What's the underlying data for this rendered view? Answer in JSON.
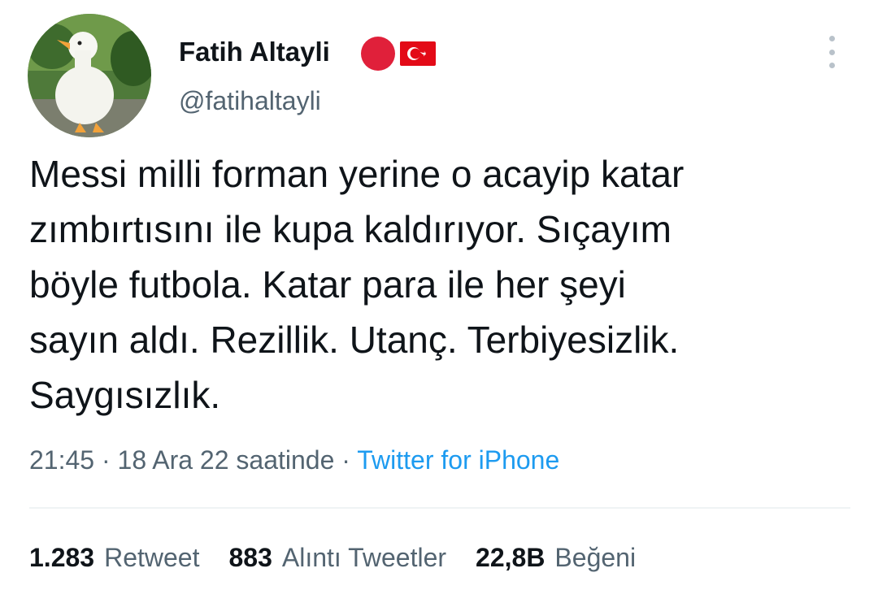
{
  "author": {
    "name": "Fatih Altayli",
    "handle": "@fatihaltayli",
    "badge_color": "#e0203a",
    "flag_icon": "turkey-flag-icon",
    "avatar_icon": "duck-avatar-icon"
  },
  "tweet": {
    "text": "Messi milli forman yerine o acayip katar\nzımbırtısını ile kupa kaldırıyor. Sıçayım\nböyle futbola. Katar para ile her şeyi\nsayın aldı.  Rezillik. Utanç. Terbiyesizlik.\nSaygısızlık.",
    "time": "21:45",
    "date": "18 Ara 22 saatinde",
    "separator": "·",
    "source": "Twitter for iPhone"
  },
  "stats": {
    "retweets": {
      "count": "1.283",
      "label": "Retweet"
    },
    "quotes": {
      "count": "883",
      "label": "Alıntı Tweetler"
    },
    "likes": {
      "count": "22,8B",
      "label": "Beğeni"
    }
  },
  "colors": {
    "text": "#0f1419",
    "secondary": "#536471",
    "link": "#1d9bf0",
    "divider": "#eff3f4"
  }
}
